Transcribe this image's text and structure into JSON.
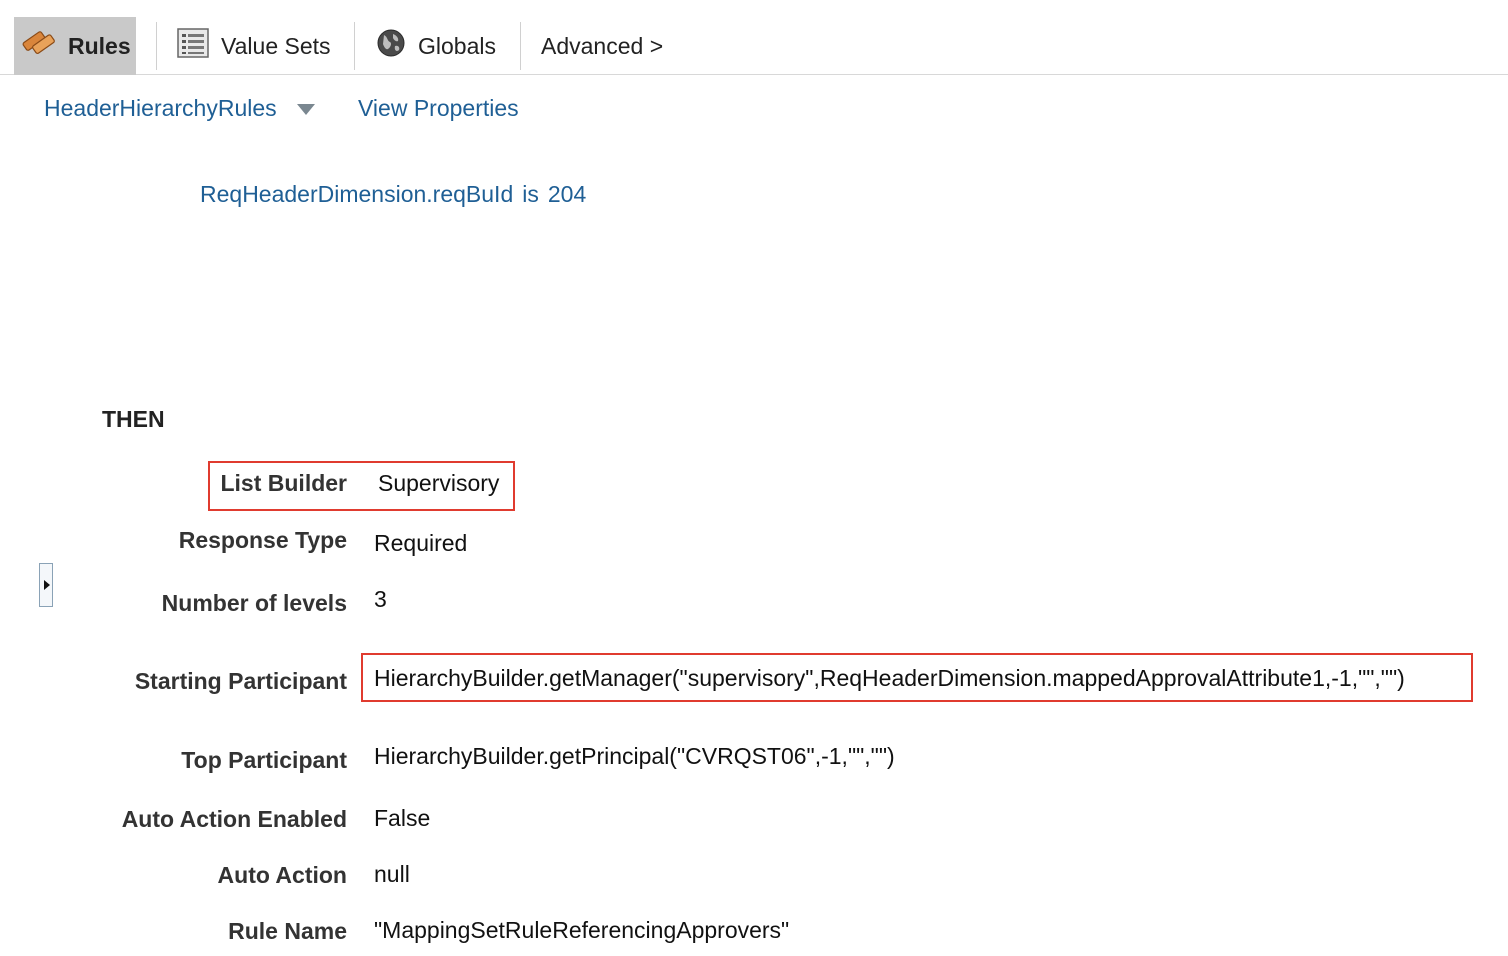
{
  "tabs": [
    {
      "label": "Rules",
      "icon": "rules-icon",
      "active": true
    },
    {
      "label": "Value Sets",
      "icon": "value-sets-icon",
      "active": false
    },
    {
      "label": "Globals",
      "icon": "globe-icon",
      "active": false
    },
    {
      "label": "Advanced >",
      "icon": "",
      "active": false
    }
  ],
  "ruleset": {
    "name": "HeaderHierarchyRules",
    "view_properties": "View Properties"
  },
  "condition": {
    "attribute": "ReqHeaderDimension.reqBuId",
    "operator": "is",
    "value": "204"
  },
  "then_label": "THEN",
  "actions": {
    "list_builder": {
      "label": "List Builder",
      "value": "Supervisory"
    },
    "response_type": {
      "label": "Response Type",
      "value": "Required"
    },
    "number_of_levels": {
      "label": "Number of levels",
      "value": "3"
    },
    "starting_participant": {
      "label": "Starting Participant",
      "value": "HierarchyBuilder.getManager(\"supervisory\",ReqHeaderDimension.mappedApprovalAttribute1,-1,\"\",\"\")"
    },
    "top_participant": {
      "label": "Top Participant",
      "value": "HierarchyBuilder.getPrincipal(\"CVRQST06\",-1,\"\",\"\")"
    },
    "auto_action_enabled": {
      "label": "Auto Action Enabled",
      "value": "False"
    },
    "auto_action": {
      "label": "Auto Action",
      "value": "null"
    },
    "rule_name": {
      "label": "Rule Name",
      "value": "\"MappingSetRuleReferencingApprovers\""
    }
  },
  "colors": {
    "link": "#1f5f95",
    "highlight_border": "#e03b2f",
    "active_tab": "#c9c9c9"
  }
}
